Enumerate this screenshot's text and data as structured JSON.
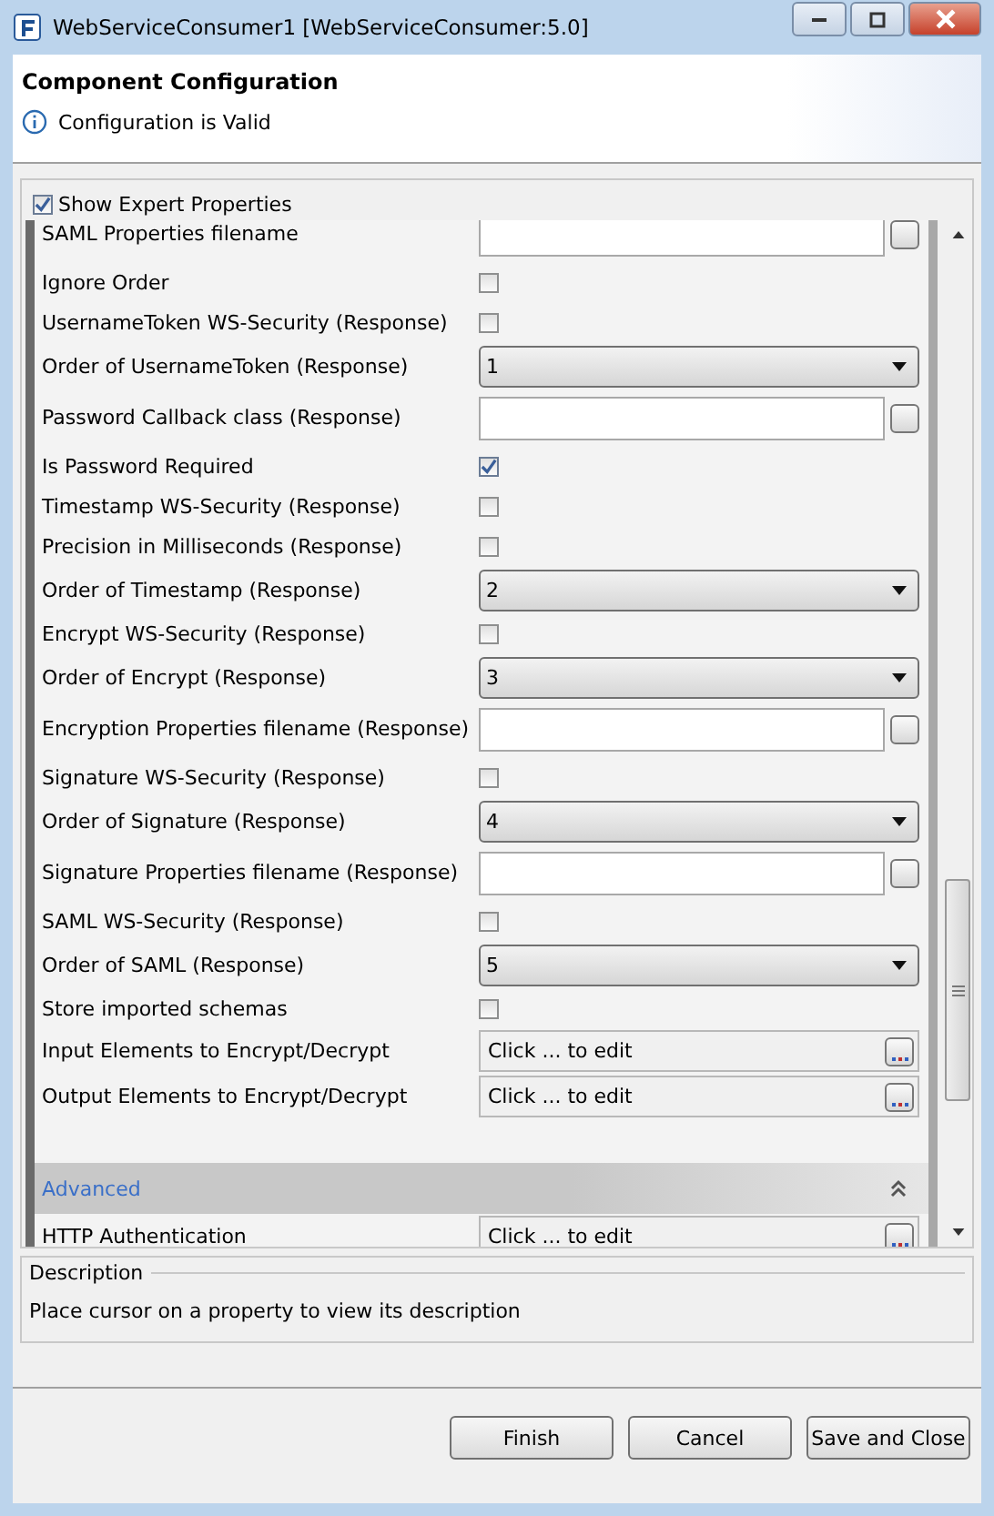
{
  "window": {
    "title": "WebServiceConsumer1 [WebServiceConsumer:5.0]"
  },
  "header": {
    "title": "Component Configuration",
    "status": "Configuration is Valid"
  },
  "show_expert_properties": {
    "label": "Show Expert Properties",
    "checked": true
  },
  "properties": [
    {
      "kind": "file",
      "label": "SAML Properties filename"
    },
    {
      "kind": "checkbox",
      "label": "Ignore Order",
      "checked": false
    },
    {
      "kind": "checkbox",
      "label": "UsernameToken WS-Security (Response)",
      "checked": false
    },
    {
      "kind": "dropdown",
      "label": "Order of UsernameToken (Response)",
      "value": "1"
    },
    {
      "kind": "file",
      "label": "Password Callback class (Response)"
    },
    {
      "kind": "checkbox",
      "label": "Is Password Required",
      "checked": true
    },
    {
      "kind": "checkbox",
      "label": "Timestamp WS-Security (Response)",
      "checked": false
    },
    {
      "kind": "checkbox",
      "label": "Precision in Milliseconds (Response)",
      "checked": false
    },
    {
      "kind": "dropdown",
      "label": "Order of Timestamp (Response)",
      "value": "2"
    },
    {
      "kind": "checkbox",
      "label": "Encrypt WS-Security (Response)",
      "checked": false
    },
    {
      "kind": "dropdown",
      "label": "Order of Encrypt (Response)",
      "value": "3"
    },
    {
      "kind": "file",
      "label": "Encryption Properties filename (Response)"
    },
    {
      "kind": "checkbox",
      "label": "Signature WS-Security (Response)",
      "checked": false
    },
    {
      "kind": "dropdown",
      "label": "Order of Signature (Response)",
      "value": "4"
    },
    {
      "kind": "file",
      "label": "Signature Properties filename (Response)"
    },
    {
      "kind": "checkbox",
      "label": "SAML WS-Security (Response)",
      "checked": false
    },
    {
      "kind": "dropdown",
      "label": "Order of SAML (Response)",
      "value": "5"
    },
    {
      "kind": "checkbox",
      "label": "Store imported schemas",
      "checked": false
    },
    {
      "kind": "edit",
      "label": "Input Elements to Encrypt/Decrypt",
      "value": "Click ... to edit"
    },
    {
      "kind": "edit",
      "label": "Output Elements to Encrypt/Decrypt",
      "value": "Click ... to edit"
    }
  ],
  "sections": [
    {
      "title": "Advanced",
      "expanded": true,
      "properties": [
        {
          "kind": "edit",
          "label": "HTTP Authentication",
          "value": "Click ... to edit"
        }
      ]
    }
  ],
  "description": {
    "title": "Description",
    "text": "Place cursor on a property to view its description"
  },
  "buttons": [
    {
      "label": "Finish"
    },
    {
      "label": "Cancel"
    },
    {
      "label": "Save and Close"
    }
  ]
}
